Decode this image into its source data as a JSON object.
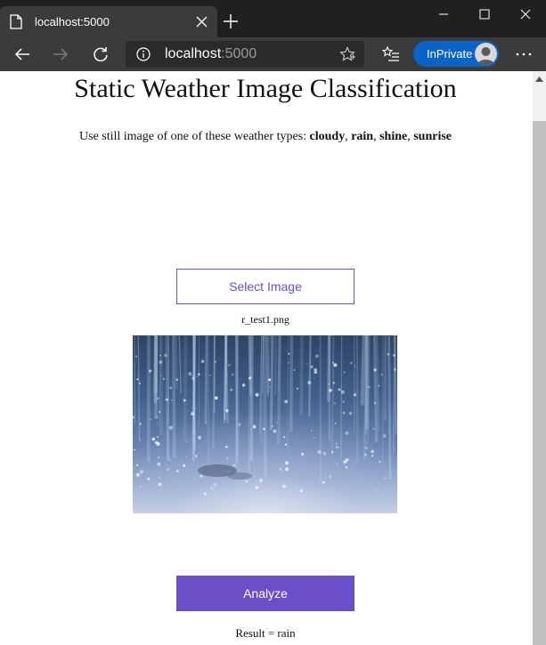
{
  "browser": {
    "tab_title": "localhost:5000",
    "url_host": "localhost",
    "url_port": ":5000",
    "inprivate_label": "InPrivate"
  },
  "page": {
    "title": "Static Weather Image Classification",
    "instructions_prefix": "Use still image of one of these weather types: ",
    "weather_types": [
      "cloudy",
      "rain",
      "shine",
      "sunrise"
    ],
    "select_button_label": "Select Image",
    "selected_filename": "r_test1.png",
    "analyze_button_label": "Analyze",
    "result_text": "Result = rain"
  },
  "colors": {
    "accent": "#6a4fc8",
    "titlebar": "#202020",
    "toolbar": "#3b3b3b",
    "inprivate": "#0a64c8"
  },
  "icons": {
    "tab": "page-icon",
    "tab_close": "close-icon",
    "new_tab": "plus-icon",
    "minimize": "minimize-icon",
    "maximize": "maximize-icon",
    "close_window": "close-icon",
    "back": "back-arrow-icon",
    "forward": "forward-arrow-icon",
    "refresh": "refresh-icon",
    "site_info": "info-icon",
    "favorite": "star-icon",
    "favorites": "favorites-icon",
    "menu": "more-icon"
  }
}
